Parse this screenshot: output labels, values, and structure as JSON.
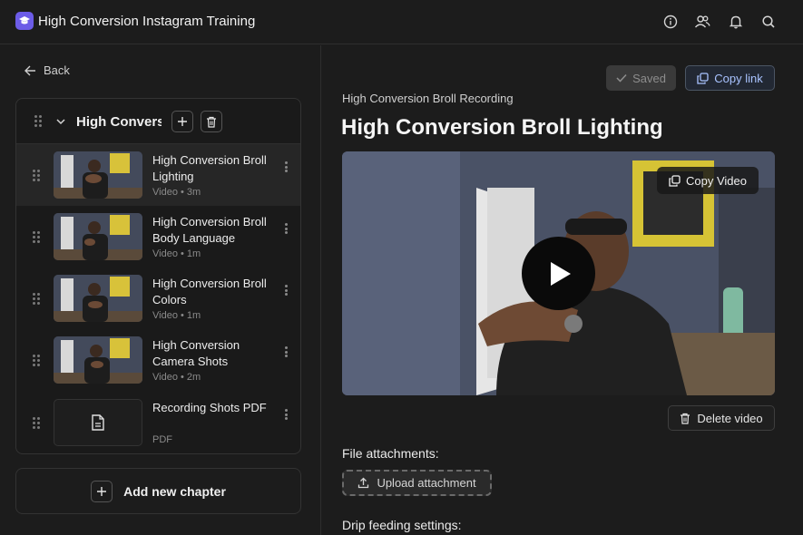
{
  "header": {
    "app_title": "High Conversion Instagram Training",
    "icons": [
      "info-icon",
      "users-icon",
      "bell-icon",
      "search-icon"
    ]
  },
  "sidebar": {
    "back_label": "Back",
    "chapter_title": "High Conversi",
    "lessons": [
      {
        "title": "High Conversion Broll Lighting",
        "meta": "Video • 3m",
        "type": "video",
        "active": true
      },
      {
        "title": "High Conversion Broll Body Language",
        "meta": "Video • 1m",
        "type": "video",
        "active": false
      },
      {
        "title": "High Conversion Broll Colors",
        "meta": "Video • 1m",
        "type": "video",
        "active": false
      },
      {
        "title": "High Conversion Camera Shots",
        "meta": "Video • 2m",
        "type": "video",
        "active": false
      },
      {
        "title": "Recording Shots PDF",
        "meta": "PDF",
        "type": "pdf",
        "active": false
      }
    ],
    "add_chapter_label": "Add new chapter"
  },
  "main": {
    "saved_label": "Saved",
    "copy_link_label": "Copy link",
    "breadcrumb": "High Conversion Broll Recording",
    "title": "High Conversion Broll Lighting",
    "copy_video_label": "Copy Video",
    "delete_video_label": "Delete video",
    "attachments_label": "File attachments:",
    "upload_label": "Upload attachment",
    "drip_label": "Drip feeding settings:"
  },
  "colors": {
    "accent": "#6c5ce7",
    "link": "#a9c3ff"
  }
}
